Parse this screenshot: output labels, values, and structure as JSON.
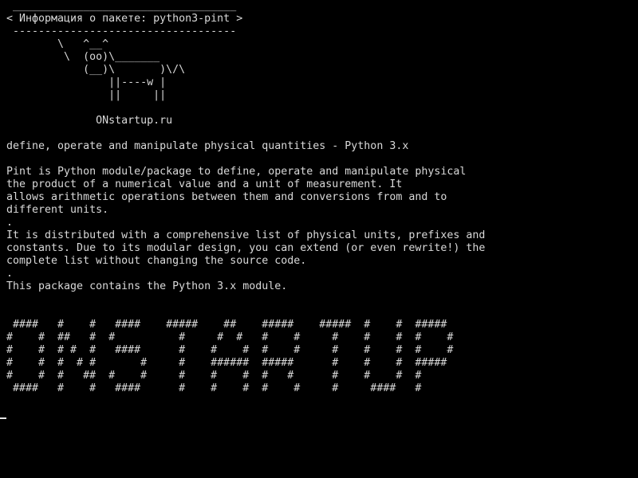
{
  "terminal": {
    "output": " ___________________________________\n< Информация о пакете: python3-pint >\n -----------------------------------\n        \\   ^__^\n         \\  (oo)\\_______\n            (__)\\       )\\/\\\n                ||----w |\n                ||     ||\n\n              ONstartup.ru\n\ndefine, operate and manipulate physical quantities - Python 3.x\n\nPint is Python module/package to define, operate and manipulate physical\nthe product of a numerical value and a unit of measurement. It\nallows arithmetic operations between them and conversions from and to\ndifferent units.\n.\nIt is distributed with a comprehensive list of physical units, prefixes and\nconstants. Due to its modular design, you can extend (or even rewrite!) the\ncomplete list without changing the source code.\n.\nThis package contains the Python 3.x module.\n\n\n ####   #    #   ####    #####    ##    #####    #####  #    #  #####\n#    #  ##   #  #          #     #  #   #    #     #    #    #  #    #\n#    #  # #  #   ####      #    #    #  #    #     #    #    #  #    #\n#    #  #  # #       #     #    ######  #####      #    #    #  #####\n#    #  #   ##  #    #     #    #    #  #   #      #    #    #  #\n ####   #    #   ####      #    #    #  #    #     #     ####   #",
    "fg_color": "#d9d9d9",
    "bg_color": "#000000"
  }
}
